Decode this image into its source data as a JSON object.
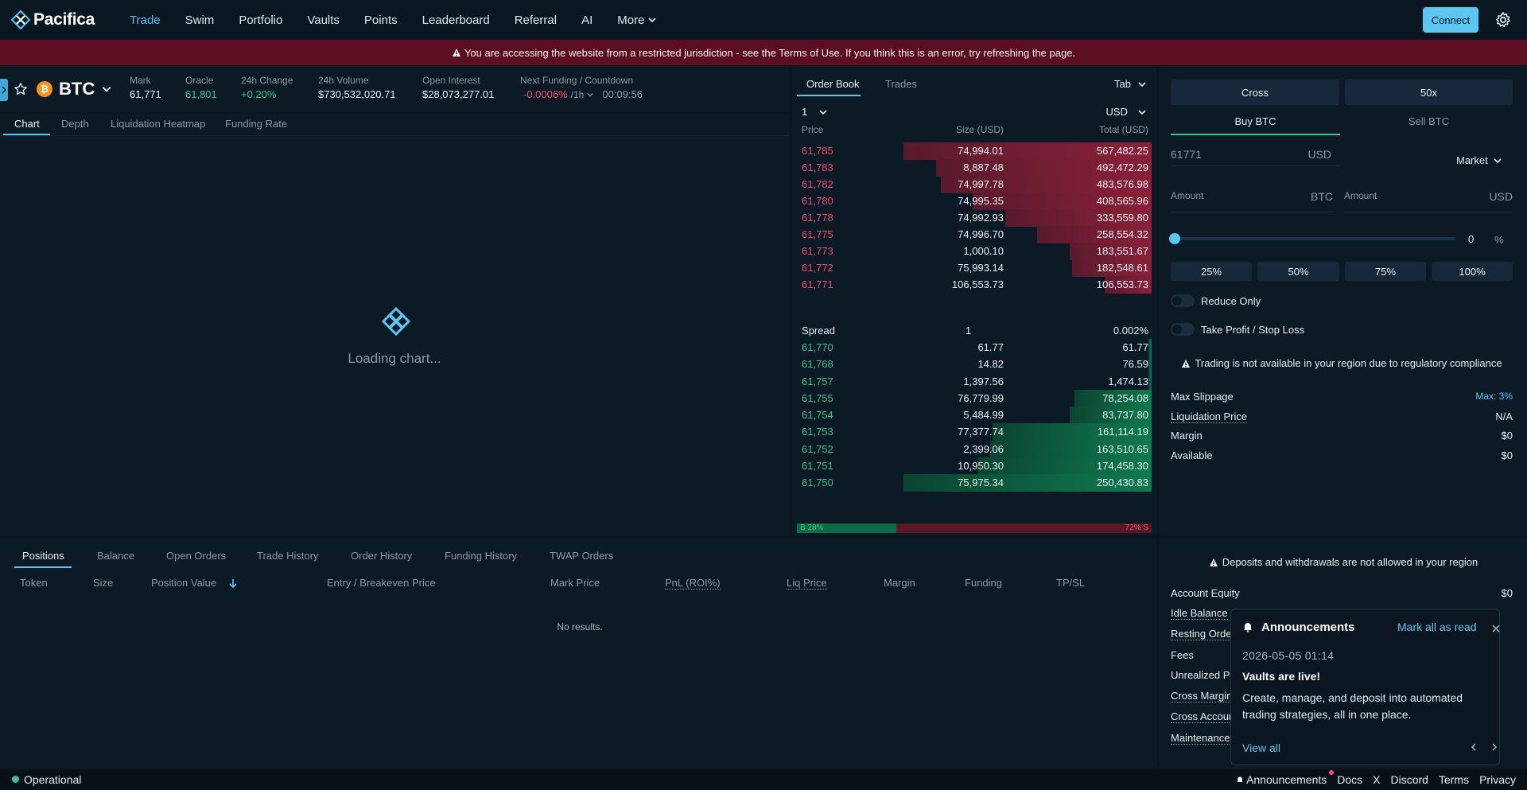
{
  "nav": {
    "brand": "Pacifica",
    "items": [
      "Trade",
      "Swim",
      "Portfolio",
      "Vaults",
      "Points",
      "Leaderboard",
      "Referral",
      "AI",
      "More"
    ],
    "connect": "Connect"
  },
  "banner": {
    "text": "You are accessing the website from a restricted jurisdiction - see the Terms of Use. If you think this is an error, try refreshing the page."
  },
  "market": {
    "symbol": "BTC",
    "stats": [
      {
        "label": "Mark",
        "value": "61,771"
      },
      {
        "label": "Oracle",
        "value": "61,801"
      },
      {
        "label": "24h Change",
        "value": "+0.20%"
      },
      {
        "label": "24h Volume",
        "value": "$730,532,020.71"
      },
      {
        "label": "Open Interest",
        "value": "$28,073,277.01"
      },
      {
        "label": "Next Funding / Countdown",
        "value": "-0.0006%",
        "interval": "/1h",
        "countdown": "00:09:56"
      }
    ]
  },
  "chart": {
    "tabs": [
      "Chart",
      "Depth",
      "Liquidation Heatmap",
      "Funding Rate"
    ],
    "loading": "Loading chart..."
  },
  "orderbook": {
    "tabs": [
      "Order Book",
      "Trades"
    ],
    "view": "Tab",
    "tick": "1",
    "currency": "USD",
    "headers": {
      "price": "Price",
      "size": "Size (USD)",
      "total": "Total (USD)"
    },
    "asks": [
      {
        "price": "61,785",
        "size": "74,994.01",
        "total": "567,482.25",
        "depth": 1.0
      },
      {
        "price": "61,783",
        "size": "8,887.48",
        "total": "492,472.29",
        "depth": 0.87
      },
      {
        "price": "61,782",
        "size": "74,997.78",
        "total": "483,576.98",
        "depth": 0.85
      },
      {
        "price": "61,780",
        "size": "74,995.35",
        "total": "408,565.96",
        "depth": 0.72
      },
      {
        "price": "61,778",
        "size": "74,992.93",
        "total": "333,559.80",
        "depth": 0.59
      },
      {
        "price": "61,775",
        "size": "74,996.70",
        "total": "258,554.32",
        "depth": 0.46
      },
      {
        "price": "61,773",
        "size": "1,000.10",
        "total": "183,551.67",
        "depth": 0.33
      },
      {
        "price": "61,772",
        "size": "75,993.14",
        "total": "182,548.61",
        "depth": 0.32
      },
      {
        "price": "61,771",
        "size": "106,553.73",
        "total": "106,553.73",
        "depth": 0.19
      }
    ],
    "spread": {
      "label": "Spread",
      "value": "1",
      "pct": "0.002%"
    },
    "bids": [
      {
        "price": "61,770",
        "size": "61.77",
        "total": "61.77",
        "depth": 0.01
      },
      {
        "price": "61,768",
        "size": "14.82",
        "total": "76.59",
        "depth": 0.01
      },
      {
        "price": "61,757",
        "size": "1,397.56",
        "total": "1,474.13",
        "depth": 0.01
      },
      {
        "price": "61,755",
        "size": "76,779.99",
        "total": "78,254.08",
        "depth": 0.31
      },
      {
        "price": "61,754",
        "size": "5,484.99",
        "total": "83,737.80",
        "depth": 0.33
      },
      {
        "price": "61,753",
        "size": "77,377.74",
        "total": "161,114.19",
        "depth": 0.64
      },
      {
        "price": "61,752",
        "size": "2,399.06",
        "total": "163,510.65",
        "depth": 0.65
      },
      {
        "price": "61,751",
        "size": "10,950.30",
        "total": "174,458.30",
        "depth": 0.7
      },
      {
        "price": "61,750",
        "size": "75,975.34",
        "total": "250,430.83",
        "depth": 1.0
      }
    ],
    "ratio": {
      "buy": "B 28%",
      "sell": "72% S",
      "buy_fraction": 0.28
    }
  },
  "trade": {
    "margin_mode": "Cross",
    "leverage": "50x",
    "sides": [
      "Buy BTC",
      "Sell BTC"
    ],
    "price_value": "61771",
    "price_unit": "USD",
    "order_type": "Market",
    "amount_btc": {
      "placeholder": "Amount",
      "unit": "BTC"
    },
    "amount_usd": {
      "placeholder": "Amount",
      "unit": "USD"
    },
    "slider_value": "0",
    "slider_unit": "%",
    "slider_fraction": 0,
    "pct_buttons": [
      "25%",
      "50%",
      "75%",
      "100%"
    ],
    "reduce_only": "Reduce Only",
    "tpsl": "Take Profit / Stop Loss",
    "warning": "Trading is not available in your region due to regulatory compliance",
    "info": [
      {
        "label": "Max Slippage",
        "value": "Max: 3%"
      },
      {
        "label": "Liquidation Price",
        "value": "N/A"
      },
      {
        "label": "Margin",
        "value": "$0"
      },
      {
        "label": "Available",
        "value": "$0"
      }
    ]
  },
  "bottom": {
    "tabs": [
      "Positions",
      "Balance",
      "Open Orders",
      "Trade History",
      "Order History",
      "Funding History",
      "TWAP Orders"
    ],
    "columns": [
      "Token",
      "Size",
      "Position Value",
      "Entry / Breakeven Price",
      "Mark Price",
      "PnL (ROI%)",
      "Liq Price",
      "Margin",
      "Funding",
      "TP/SL"
    ],
    "empty": "No results."
  },
  "account": {
    "warning": "Deposits and withdrawals are not allowed in your region",
    "rows": [
      {
        "label": "Account Equity",
        "value": "$0"
      },
      {
        "label": "Idle Balance",
        "value": ""
      },
      {
        "label": "Resting Order",
        "value": ""
      },
      {
        "label": "Fees",
        "value": ""
      },
      {
        "label": "Unrealized Pr",
        "value": ""
      },
      {
        "label": "Cross Margin",
        "value": ""
      },
      {
        "label": "Cross Accoun",
        "value": ""
      },
      {
        "label": "Maintenance",
        "value": ""
      }
    ]
  },
  "announcement": {
    "title": "Announcements",
    "mark_read": "Mark all as read",
    "date": "2026-05-05 01:14",
    "headline": "Vaults are live!",
    "body": "Create, manage, and deposit into automated trading strategies, all in one place.",
    "view_all": "View all"
  },
  "status": {
    "state": "Operational",
    "links": [
      "Announcements",
      "Docs",
      "X",
      "Discord",
      "Terms",
      "Privacy"
    ]
  },
  "colors": {
    "accent": "#5bc6ef",
    "buy": "#37c58a",
    "sell": "#ec4f6d",
    "banner": "#5b0f21"
  }
}
